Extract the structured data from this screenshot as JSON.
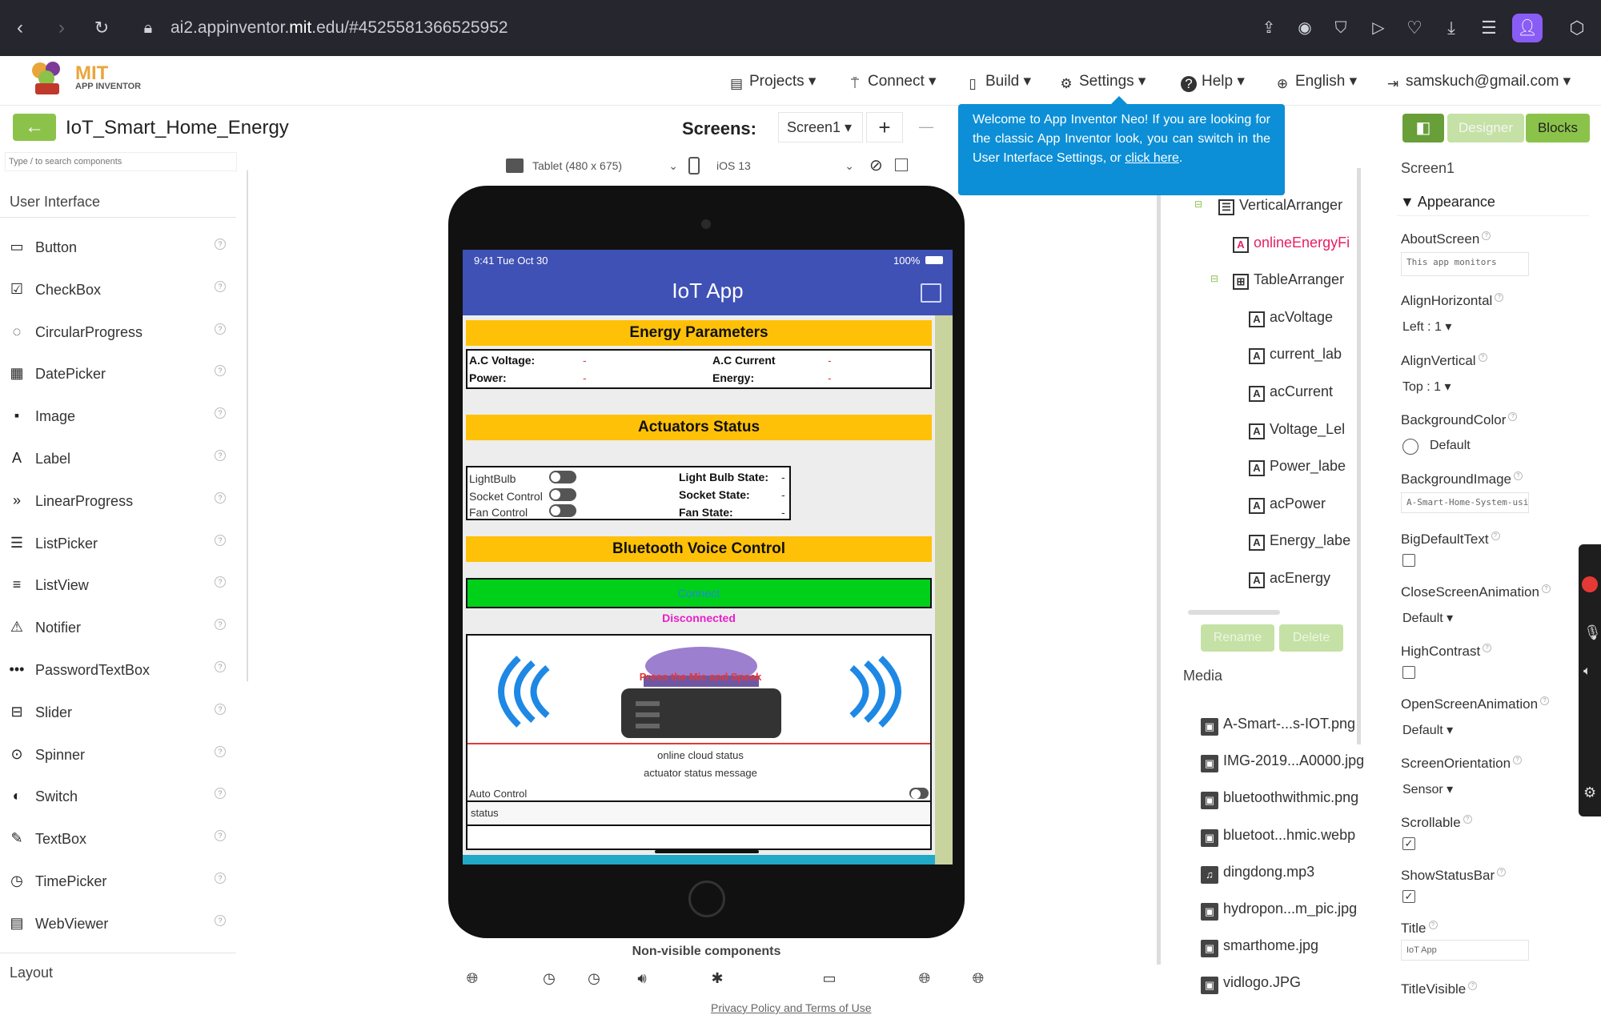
{
  "browser": {
    "url": "ai2.appinventor.mit.edu/#4525581366525952",
    "url_domain": "ai2.appinventor.",
    "url_domain_bold": "mit",
    "url_rest": ".edu/#4525581366525952"
  },
  "app": {
    "logo_mit": "MIT",
    "logo_sub": "APP INVENTOR",
    "menu": [
      {
        "label": "Projects",
        "icon": "folder-icon"
      },
      {
        "label": "Connect",
        "icon": "antenna-icon"
      },
      {
        "label": "Build",
        "icon": "phone-download-icon"
      },
      {
        "label": "Settings",
        "icon": "gear-icon"
      },
      {
        "label": "Help",
        "icon": "help-icon"
      },
      {
        "label": "English",
        "icon": "globe-icon"
      },
      {
        "label": "samskuch@gmail.com",
        "icon": "logout-icon"
      }
    ]
  },
  "project": {
    "name": "IoT_Smart_Home_Energy",
    "screens_label": "Screens:",
    "screen_select": "Screen1",
    "add": "+",
    "remove": "—",
    "designer": "Designer",
    "blocks": "Blocks"
  },
  "tooltip": {
    "text": "Welcome to App Inventor Neo! If you are looking for the classic App Inventor look, you can switch in the User Interface Settings, or ",
    "link": "click here",
    "end": "."
  },
  "palette": {
    "search_placeholder": "Type / to search components",
    "category": "User Interface",
    "items": [
      {
        "label": "Button",
        "icon": "button-icon",
        "glyph": "▭"
      },
      {
        "label": "CheckBox",
        "icon": "checkbox-icon",
        "glyph": "☑"
      },
      {
        "label": "CircularProgress",
        "icon": "circular-progress-icon",
        "glyph": "◌"
      },
      {
        "label": "DatePicker",
        "icon": "calendar-icon",
        "glyph": "▦"
      },
      {
        "label": "Image",
        "icon": "image-icon",
        "glyph": "▪"
      },
      {
        "label": "Label",
        "icon": "label-icon",
        "glyph": "A"
      },
      {
        "label": "LinearProgress",
        "icon": "linear-progress-icon",
        "glyph": "»"
      },
      {
        "label": "ListPicker",
        "icon": "listpicker-icon",
        "glyph": "☰"
      },
      {
        "label": "ListView",
        "icon": "listview-icon",
        "glyph": "≡"
      },
      {
        "label": "Notifier",
        "icon": "notifier-icon",
        "glyph": "⚠"
      },
      {
        "label": "PasswordTextBox",
        "icon": "password-icon",
        "glyph": "•••"
      },
      {
        "label": "Slider",
        "icon": "slider-icon",
        "glyph": "⊟"
      },
      {
        "label": "Spinner",
        "icon": "spinner-icon",
        "glyph": "⊙"
      },
      {
        "label": "Switch",
        "icon": "switch-icon",
        "glyph": "◐"
      },
      {
        "label": "TextBox",
        "icon": "textbox-icon",
        "glyph": "✎"
      },
      {
        "label": "TimePicker",
        "icon": "clock-icon",
        "glyph": "◷"
      },
      {
        "label": "WebViewer",
        "icon": "webviewer-icon",
        "glyph": "▤"
      }
    ],
    "layout": "Layout",
    "help": "?"
  },
  "viewer": {
    "device": "Tablet (480 x 675)",
    "os": "iOS 13",
    "nonvisible": "Non-visible components",
    "nonvisible_icons": [
      "globe-icon",
      "clock-icon",
      "clock-icon",
      "sound-icon",
      "bluetooth-icon",
      "speech-icon",
      "globe-icon",
      "globe-icon"
    ],
    "footer": "Privacy Policy and Terms of Use"
  },
  "phone": {
    "status_time": "9:41 Tue Oct 30",
    "battery": "100%",
    "title": "IoT App",
    "energy_header": "Energy Parameters",
    "ac_voltage": "A.C Voltage:",
    "ac_current": "A.C Current",
    "power": "Power:",
    "energy": "Energy:",
    "dash": "-",
    "actuators_header": "Actuators Status",
    "lightbulb": "LightBulb",
    "socket_control": "Socket Control",
    "fan_control": "Fan Control",
    "lightbulb_state": "Light Bulb State:",
    "socket_state": "Socket State:",
    "fan_state": "Fan State:",
    "bt_header": "Bluetooth Voice Control",
    "connect": "Connect",
    "disconnected": "Disconnected",
    "press": "Press the Mic and Speak",
    "cloud_status": "online cloud status",
    "actuator_msg": "actuator status message",
    "auto_control": "Auto Control",
    "status": "status"
  },
  "components": {
    "nodes": [
      {
        "label": "VerticalArranger",
        "icon": "vertical-arranger-icon",
        "glyph": "☰"
      },
      {
        "label": "onlineEnergyFi",
        "icon": "label-icon",
        "glyph": "A"
      },
      {
        "label": "TableArranger",
        "icon": "table-arranger-icon",
        "glyph": "⊞"
      },
      {
        "label": "acVoltage",
        "icon": "label-icon",
        "glyph": "A"
      },
      {
        "label": "current_lab",
        "icon": "label-icon",
        "glyph": "A"
      },
      {
        "label": "acCurrent",
        "icon": "label-icon",
        "glyph": "A"
      },
      {
        "label": "Voltage_Lel",
        "icon": "label-icon",
        "glyph": "A"
      },
      {
        "label": "Power_labe",
        "icon": "label-icon",
        "glyph": "A"
      },
      {
        "label": "acPower",
        "icon": "label-icon",
        "glyph": "A"
      },
      {
        "label": "Energy_labe",
        "icon": "label-icon",
        "glyph": "A"
      },
      {
        "label": "acEnergy",
        "icon": "label-icon",
        "glyph": "A"
      }
    ],
    "rename": "Rename",
    "delete": "Delete",
    "media_title": "Media",
    "media": [
      {
        "label": "A-Smart-...s-IOT.png",
        "icon": "image-icon"
      },
      {
        "label": "IMG-2019...A0000.jpg",
        "icon": "image-icon"
      },
      {
        "label": "bluetoothwithmic.png",
        "icon": "image-icon"
      },
      {
        "label": "bluetoot...hmic.webp",
        "icon": "image-icon"
      },
      {
        "label": "dingdong.mp3",
        "icon": "music-icon"
      },
      {
        "label": "hydropon...m_pic.jpg",
        "icon": "image-icon"
      },
      {
        "label": "smarthome.jpg",
        "icon": "image-icon"
      },
      {
        "label": "vidlogo.JPG",
        "icon": "image-icon"
      }
    ]
  },
  "properties": {
    "screen": "Screen1",
    "group": "Appearance",
    "about_screen_label": "AboutScreen",
    "about_screen_value": "This app monitors",
    "align_h_label": "AlignHorizontal",
    "align_h_value": "Left : 1",
    "align_v_label": "AlignVertical",
    "align_v_value": "Top : 1",
    "bgcolor_label": "BackgroundColor",
    "bgcolor_value": "Default",
    "bgimage_label": "BackgroundImage",
    "bgimage_value": "A-Smart-Home-System-usir",
    "bigtext_label": "BigDefaultText",
    "close_anim_label": "CloseScreenAnimation",
    "close_anim_value": "Default",
    "high_contrast_label": "HighContrast",
    "open_anim_label": "OpenScreenAnimation",
    "open_anim_value": "Default",
    "orientation_label": "ScreenOrientation",
    "orientation_value": "Sensor",
    "scrollable_label": "Scrollable",
    "statusbar_label": "ShowStatusBar",
    "title_label": "Title",
    "title_value": "IoT App",
    "title_visible_label": "TitleVisible",
    "check": "✓"
  },
  "colors": {
    "green": "#8bc34a",
    "yellow": "#ffc107",
    "blue_header": "#3f51b5",
    "tooltip": "#0c8fd6",
    "connect_green": "#00d01a",
    "disconnected": "#e91ec9"
  }
}
